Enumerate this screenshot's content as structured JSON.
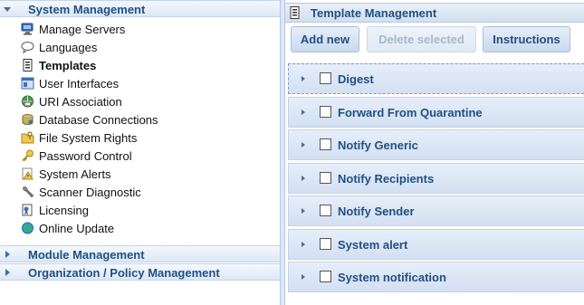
{
  "nav": {
    "system_management": {
      "label": "System Management",
      "expanded": true,
      "items": [
        {
          "label": "Manage Servers",
          "icon": "monitor-icon"
        },
        {
          "label": "Languages",
          "icon": "speech-bubble-icon"
        },
        {
          "label": "Templates",
          "icon": "template-document-icon",
          "active": true
        },
        {
          "label": "User Interfaces",
          "icon": "user-interface-icon"
        },
        {
          "label": "URI Association",
          "icon": "globe-link-icon"
        },
        {
          "label": "Database Connections",
          "icon": "database-icon"
        },
        {
          "label": "File System Rights",
          "icon": "folder-key-icon"
        },
        {
          "label": "Password Control",
          "icon": "key-icon"
        },
        {
          "label": "System Alerts",
          "icon": "warning-icon"
        },
        {
          "label": "Scanner Diagnostic",
          "icon": "wrench-icon"
        },
        {
          "label": "Licensing",
          "icon": "certificate-icon"
        },
        {
          "label": "Online Update",
          "icon": "update-globe-icon"
        }
      ]
    },
    "module_management": {
      "label": "Module Management",
      "expanded": false
    },
    "org_policy_management": {
      "label": "Organization / Policy Management",
      "expanded": false
    }
  },
  "panel": {
    "title": "Template Management",
    "toolbar": {
      "add_new": "Add new",
      "delete_selected": "Delete selected",
      "instructions": "Instructions"
    },
    "templates": [
      {
        "name": "Digest",
        "checked": false
      },
      {
        "name": "Forward From Quarantine",
        "checked": false
      },
      {
        "name": "Notify Generic",
        "checked": false
      },
      {
        "name": "Notify Recipients",
        "checked": false
      },
      {
        "name": "Notify Sender",
        "checked": false
      },
      {
        "name": "System alert",
        "checked": false
      },
      {
        "name": "System notification",
        "checked": false
      }
    ]
  },
  "colors": {
    "header_text": "#1f4f84",
    "header_bg": "#dde8f5",
    "row_bg": "#dbe6f4",
    "disabled_text": "#a8b8cc"
  }
}
